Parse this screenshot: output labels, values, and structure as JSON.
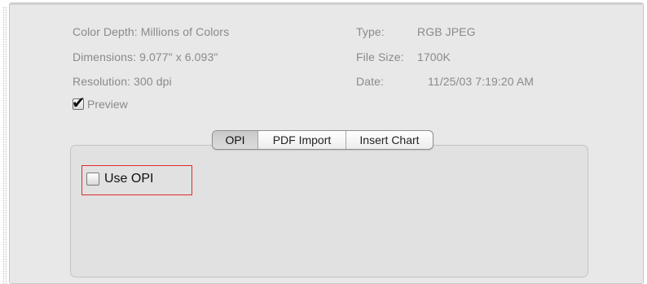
{
  "info": {
    "color_depth": "Color Depth: Millions of Colors",
    "dimensions": "Dimensions: 9.077\" x 6.093\"",
    "resolution": "Resolution:  300 dpi",
    "type_label": "Type:",
    "type_value": "RGB JPEG",
    "size_label": "File Size:",
    "size_value": "1700K",
    "date_label": "Date:",
    "date_value": "11/25/03 7:19:20 AM"
  },
  "preview": {
    "label": "Preview",
    "checked": true
  },
  "tabs": [
    {
      "label": "OPI",
      "selected": true
    },
    {
      "label": "PDF Import",
      "selected": false
    },
    {
      "label": "Insert Chart",
      "selected": false
    }
  ],
  "opi": {
    "use_opi_label": "Use OPI",
    "checked": false
  },
  "colors": {
    "highlight": "#e02a2a",
    "panel_bg": "#e8e8e8",
    "label_text": "#8a8a8a"
  }
}
